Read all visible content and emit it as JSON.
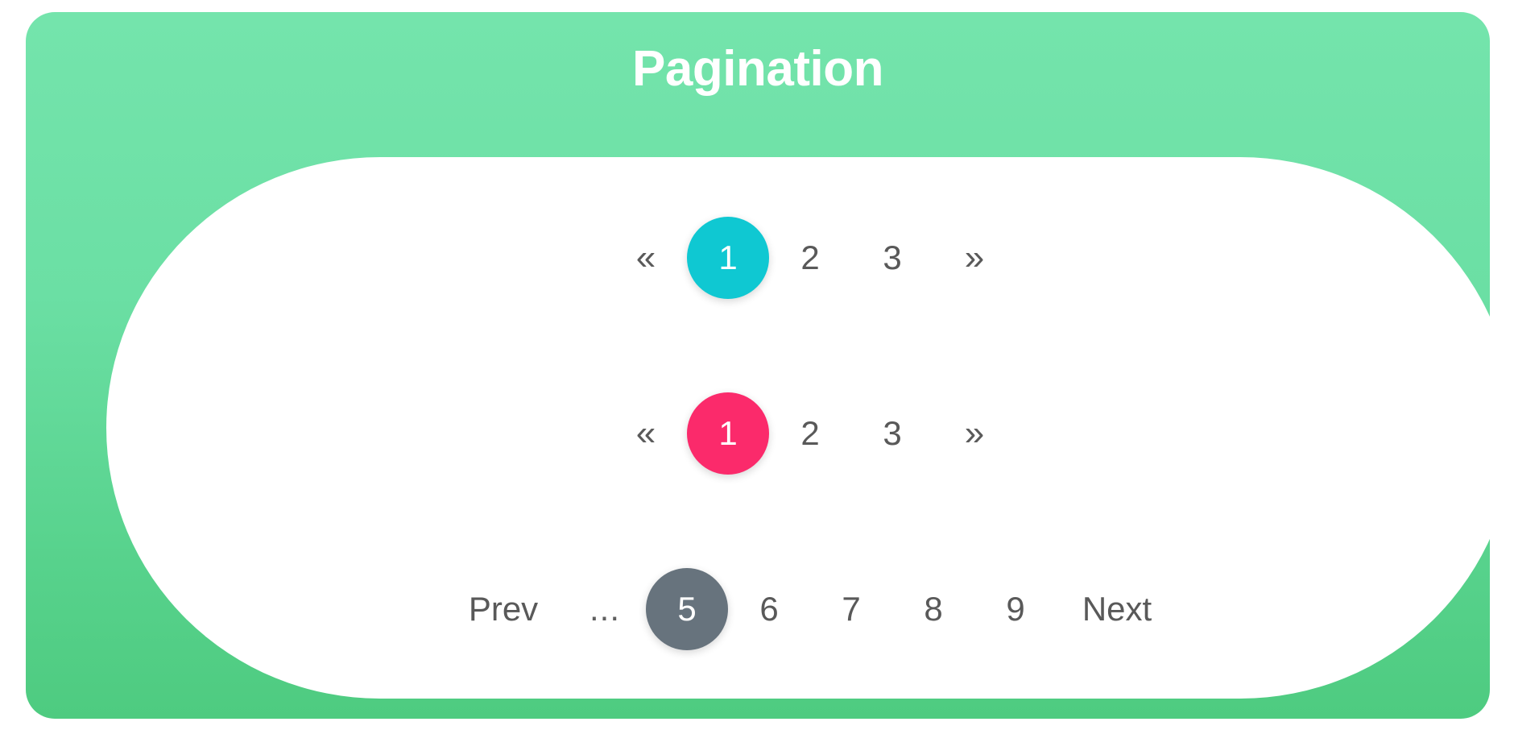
{
  "panel": {
    "title": "Pagination",
    "bg_gradient_start": "#74E4AC",
    "bg_gradient_end": "#4ECB80",
    "title_color": "#FFFFFF",
    "card_bg": "#FFFFFF"
  },
  "colors": {
    "inactive_text": "#595959",
    "chevron": "#5A5A5A",
    "active_cyan": "#0FC8D2",
    "active_pink": "#FB2A6B",
    "active_gray": "#67737D"
  },
  "pagers": [
    {
      "name": "pagination-cyan",
      "accent": "#0FC8D2",
      "items": [
        {
          "label": "«",
          "kind": "chevron",
          "name": "prev-page-icon",
          "active": false
        },
        {
          "label": "1",
          "kind": "page",
          "name": "page-1",
          "active": true
        },
        {
          "label": "2",
          "kind": "page",
          "name": "page-2",
          "active": false
        },
        {
          "label": "3",
          "kind": "page",
          "name": "page-3",
          "active": false
        },
        {
          "label": "»",
          "kind": "chevron",
          "name": "next-page-icon",
          "active": false
        }
      ]
    },
    {
      "name": "pagination-pink",
      "accent": "#FB2A6B",
      "items": [
        {
          "label": "«",
          "kind": "chevron",
          "name": "prev-page-icon",
          "active": false
        },
        {
          "label": "1",
          "kind": "page",
          "name": "page-1",
          "active": true
        },
        {
          "label": "2",
          "kind": "page",
          "name": "page-2",
          "active": false
        },
        {
          "label": "3",
          "kind": "page",
          "name": "page-3",
          "active": false
        },
        {
          "label": "»",
          "kind": "chevron",
          "name": "next-page-icon",
          "active": false
        }
      ]
    },
    {
      "name": "pagination-gray",
      "accent": "#67737D",
      "items": [
        {
          "label": "Prev",
          "kind": "nav",
          "name": "prev-button",
          "active": false
        },
        {
          "label": "...",
          "kind": "ellipsis",
          "name": "page-ellipsis",
          "active": false
        },
        {
          "label": "5",
          "kind": "page",
          "name": "page-5",
          "active": true
        },
        {
          "label": "6",
          "kind": "page",
          "name": "page-6",
          "active": false
        },
        {
          "label": "7",
          "kind": "page",
          "name": "page-7",
          "active": false
        },
        {
          "label": "8",
          "kind": "page",
          "name": "page-8",
          "active": false
        },
        {
          "label": "9",
          "kind": "page",
          "name": "page-9",
          "active": false
        },
        {
          "label": "Next",
          "kind": "nav",
          "name": "next-button",
          "active": false
        }
      ]
    }
  ]
}
